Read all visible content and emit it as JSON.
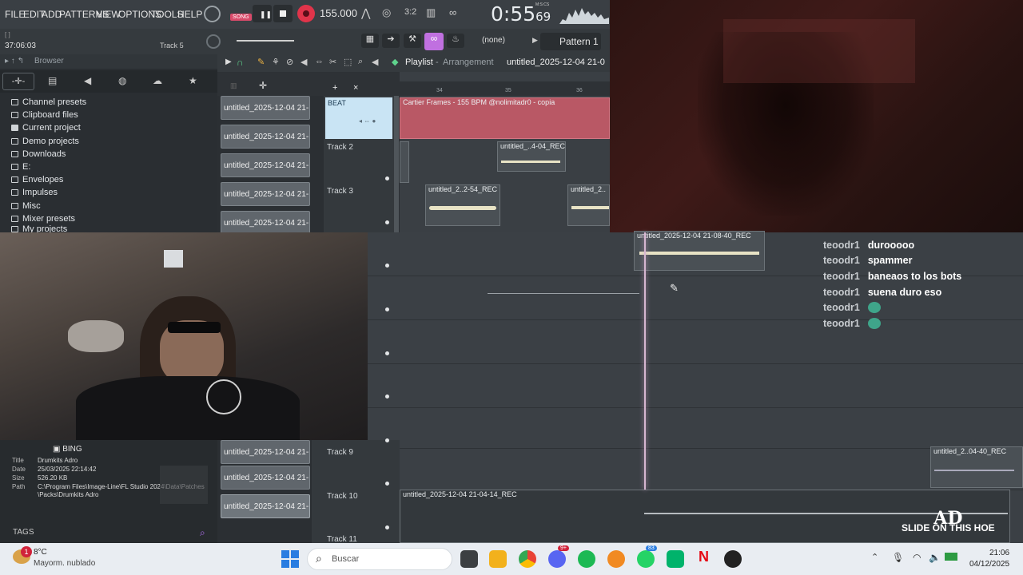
{
  "menu": {
    "items": [
      "FILE",
      "EDIT",
      "ADD",
      "PATTERNS",
      "VIEW",
      "OPTIONS",
      "TOOLS",
      "HELP"
    ]
  },
  "transport": {
    "song_label": "SONG",
    "tempo": "155.000",
    "time_main": "0:55",
    "time_sub": "69",
    "time_unit": "M:S:CS"
  },
  "toolbar2": {
    "time": "37:06:03",
    "track_hint": "Track 5",
    "snap": "(none)",
    "pattern": "Pattern 1"
  },
  "browser": {
    "title": "Browser",
    "items": [
      "Channel presets",
      "Clipboard files",
      "Current project",
      "Demo projects",
      "Downloads",
      "E:",
      "Envelopes",
      "Impulses",
      "Misc",
      "Mixer presets",
      "My projects"
    ],
    "info": {
      "name": "BING",
      "title_label": "Title",
      "title": "Drumkits Adro",
      "date_label": "Date",
      "date": "25/03/2025 22:14:42",
      "size_label": "Size",
      "size": "526.20 KB",
      "path_label": "Path",
      "path": "C:\\Program Files\\Image-Line\\FL Studio 2024\\Data\\Patches\\Packs\\Drumkits Adro"
    },
    "tags": "TAGS"
  },
  "playlist": {
    "title": "Playlist",
    "subtitle": "Arrangement",
    "project": "untitled_2025-12-04 21-0",
    "ruler": [
      "34",
      "35",
      "36"
    ],
    "patterns": [
      "untitled_2025-12-04 21-...",
      "untitled_2025-12-04 21-...",
      "untitled_2025-12-04 21-...",
      "untitled_2025-12-04 21-...",
      "untitled_2025-12-04 21-..."
    ],
    "patterns_lower": [
      "untitled_2025-12-04 21-...",
      "untitled_2025-12-04 21-...",
      "untitled_2025-12-04 21-..."
    ],
    "tracks": {
      "beat": "BEAT",
      "t2": "Track 2",
      "t3": "Track 3",
      "t9": "Track 9",
      "t10": "Track 10",
      "t11": "Track 11"
    },
    "clips": {
      "beat": "Cartier Frames - 155 BPM @nolimitadr0 - copia",
      "t2": "untitled_..4-04_REC",
      "t3a": "untitled_2..2-54_REC",
      "t3b": "untitled_2..",
      "t4": "untitled_2025-12-04 21-08-40_REC",
      "t9": "untitled_2..04-40_REC",
      "t10": "untitled_2025-12-04 21-04-14_REC"
    }
  },
  "chat": [
    {
      "user": "teoodr1",
      "text": "durooooo"
    },
    {
      "user": "teoodr1",
      "text": "spammer"
    },
    {
      "user": "teoodr1",
      "text": "baneaos to los bots"
    },
    {
      "user": "teoodr1",
      "text": "suena duro eso"
    },
    {
      "user": "teoodr1",
      "text": ""
    },
    {
      "user": "teoodr1",
      "text": ""
    }
  ],
  "watermark": "SLIDE ON THIS HOE",
  "taskbar": {
    "weather_temp": "8°C",
    "weather_desc": "Mayorm. nublado",
    "weather_badge": "1",
    "search": "Buscar",
    "discord_badge": "9+",
    "whatsapp_badge": "83",
    "time": "21:06",
    "date": "04/12/2025"
  }
}
